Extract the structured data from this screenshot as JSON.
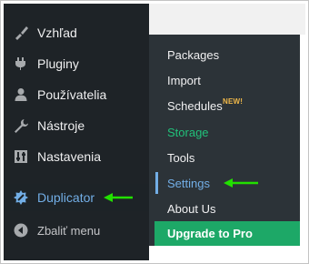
{
  "sidebar": {
    "items": [
      {
        "label": "Vzhľad",
        "icon": "brush-icon"
      },
      {
        "label": "Pluginy",
        "icon": "plugin-icon"
      },
      {
        "label": "Používatelia",
        "icon": "user-icon"
      },
      {
        "label": "Nástroje",
        "icon": "wrench-icon"
      },
      {
        "label": "Nastavenia",
        "icon": "settings-sliders-icon"
      },
      {
        "label": "Duplicator",
        "icon": "duplicator-icon",
        "current": true
      }
    ],
    "collapse_label": "Zbaliť menu"
  },
  "submenu": {
    "items": [
      {
        "label": "Packages"
      },
      {
        "label": "Import"
      },
      {
        "label": "Schedules",
        "badge": "NEW!"
      },
      {
        "label": "Storage"
      },
      {
        "label": "Tools"
      },
      {
        "label": "Settings",
        "active": true
      },
      {
        "label": "About Us"
      }
    ],
    "upgrade_label": "Upgrade to Pro"
  },
  "colors": {
    "sidebar_bg": "#1e2327",
    "submenu_bg": "#2c3338",
    "accent_blue": "#72aee6",
    "storage_green": "#21c17a",
    "upgrade_green": "#1da867",
    "badge_orange": "#f0b849",
    "arrow_green": "#22e000"
  }
}
